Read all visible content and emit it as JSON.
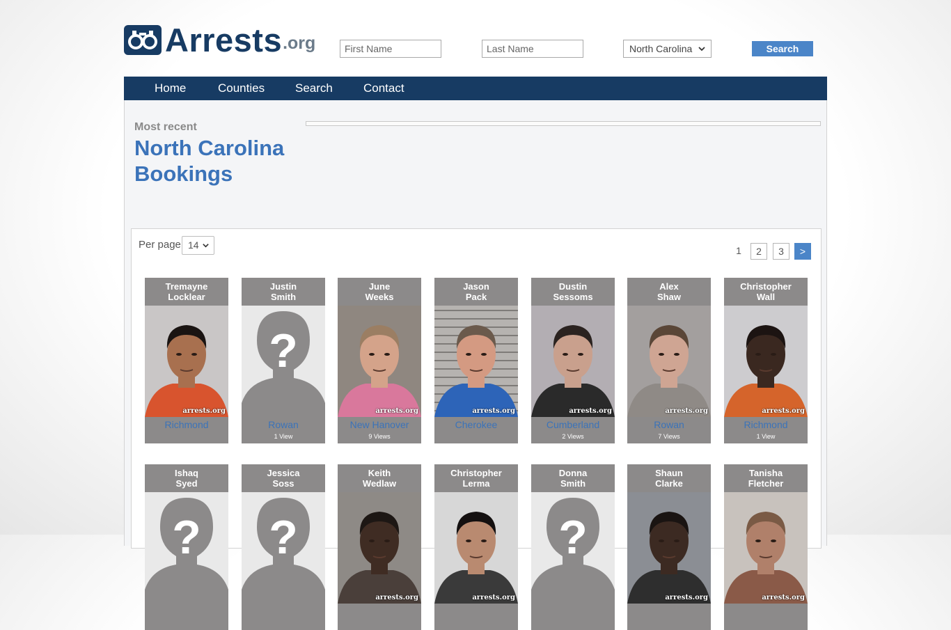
{
  "header": {
    "logo_text": "Arrests",
    "logo_suffix": ".org",
    "first_name_placeholder": "First Name",
    "last_name_placeholder": "Last Name",
    "state_selected": "North Carolina",
    "search_label": "Search"
  },
  "nav": {
    "items": [
      "Home",
      "Counties",
      "Search",
      "Contact"
    ]
  },
  "main": {
    "kicker": "Most recent",
    "title_line1": "North Carolina",
    "title_line2": "Bookings"
  },
  "listing": {
    "per_page_label": "Per page",
    "per_page_value": "14",
    "pages": [
      "1",
      "2",
      "3"
    ],
    "next_label": ">",
    "watermark": "arrests.org"
  },
  "bookings": [
    {
      "first": "Tremayne",
      "last": "Locklear",
      "county": "Richmond",
      "views": "",
      "photo": "mugshot",
      "bg": "#c9c6c6",
      "skin": "#a8704f",
      "shirt": "#d8542e",
      "hair": "#1a1412"
    },
    {
      "first": "Justin",
      "last": "Smith",
      "county": "Rowan",
      "views": "1 View",
      "photo": "placeholder"
    },
    {
      "first": "June",
      "last": "Weeks",
      "county": "New Hanover",
      "views": "9 Views",
      "photo": "mugshot",
      "bg": "#8f8780",
      "skin": "#d4a38a",
      "shirt": "#d9789c",
      "hair": "#9b7e63"
    },
    {
      "first": "Jason",
      "last": "Pack",
      "county": "Cherokee",
      "views": "",
      "photo": "mugshot",
      "bg": "#b6b3b0",
      "skin": "#d49a82",
      "shirt": "#2d64b8",
      "hair": "#6b5a4c",
      "stripes": true
    },
    {
      "first": "Dustin",
      "last": "Sessoms",
      "county": "Cumberland",
      "views": "2 Views",
      "photo": "mugshot",
      "bg": "#b3aeb3",
      "skin": "#c9a08d",
      "shirt": "#2a2a2a",
      "hair": "#2b2320"
    },
    {
      "first": "Alex",
      "last": "Shaw",
      "county": "Rowan",
      "views": "7 Views",
      "photo": "mugshot",
      "bg": "#a39f9e",
      "skin": "#cfa593",
      "shirt": "#8f8a86",
      "hair": "#5a4637"
    },
    {
      "first": "Christopher",
      "last": "Wall",
      "county": "Richmond",
      "views": "1 View",
      "photo": "mugshot",
      "bg": "#cdcccf",
      "skin": "#3a2820",
      "shirt": "#d5642b",
      "hair": "#1c1412"
    },
    {
      "first": "Ishaq",
      "last": "Syed",
      "county": "",
      "views": "",
      "photo": "placeholder"
    },
    {
      "first": "Jessica",
      "last": "Soss",
      "county": "",
      "views": "",
      "photo": "placeholder"
    },
    {
      "first": "Keith",
      "last": "Wedlaw",
      "county": "",
      "views": "",
      "photo": "mugshot",
      "bg": "#8e8a86",
      "skin": "#3f2c23",
      "shirt": "#4a3f3a",
      "hair": "#1d1714"
    },
    {
      "first": "Christopher",
      "last": "Lerma",
      "county": "",
      "views": "",
      "photo": "mugshot",
      "bg": "#d7d7d7",
      "skin": "#b98a70",
      "shirt": "#3a3a3a",
      "hair": "#141010"
    },
    {
      "first": "Donna",
      "last": "Smith",
      "county": "",
      "views": "",
      "photo": "placeholder"
    },
    {
      "first": "Shaun",
      "last": "Clarke",
      "county": "",
      "views": "",
      "photo": "mugshot",
      "bg": "#8b8e94",
      "skin": "#3c2a22",
      "shirt": "#2e2e2e",
      "hair": "#1a1412"
    },
    {
      "first": "Tanisha",
      "last": "Fletcher",
      "county": "",
      "views": "",
      "photo": "mugshot",
      "bg": "#c8c2bd",
      "skin": "#b0806a",
      "shirt": "#8a5a48",
      "hair": "#7a5a45"
    }
  ]
}
